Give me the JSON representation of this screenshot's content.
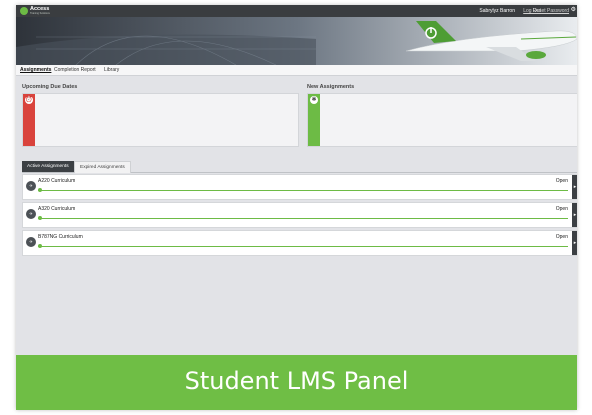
{
  "app": {
    "brand": "Access",
    "brand_sub": "Training Solutions"
  },
  "header": {
    "user_name": "Sabrylyz Barron",
    "logout_label": "Log Out",
    "reset_password_label": "Reset Password",
    "settings_icon": "gear-icon"
  },
  "nav": {
    "items": [
      "Assignments",
      "Completion Report",
      "Library"
    ],
    "active": "Assignments"
  },
  "upcoming": {
    "title": "Upcoming Due Dates",
    "icon": "alarm-icon",
    "color": "#d9433c"
  },
  "new_assignments": {
    "title": "New Assignments",
    "icon": "star-icon",
    "color": "#6dbb45"
  },
  "tabs": [
    "Active Assignments",
    "Expired Assignments"
  ],
  "assignments": [
    {
      "name": "A220 Curriculum",
      "status": "Open",
      "progress": 0
    },
    {
      "name": "A320 Curriculum",
      "status": "Open",
      "progress": 0
    },
    {
      "name": "B787NG Curriculum",
      "status": "Open",
      "progress": 0
    }
  ],
  "caption": "Student LMS Panel",
  "colors": {
    "accent": "#6dbb45",
    "dark": "#3c4044",
    "alert": "#d9433c"
  }
}
